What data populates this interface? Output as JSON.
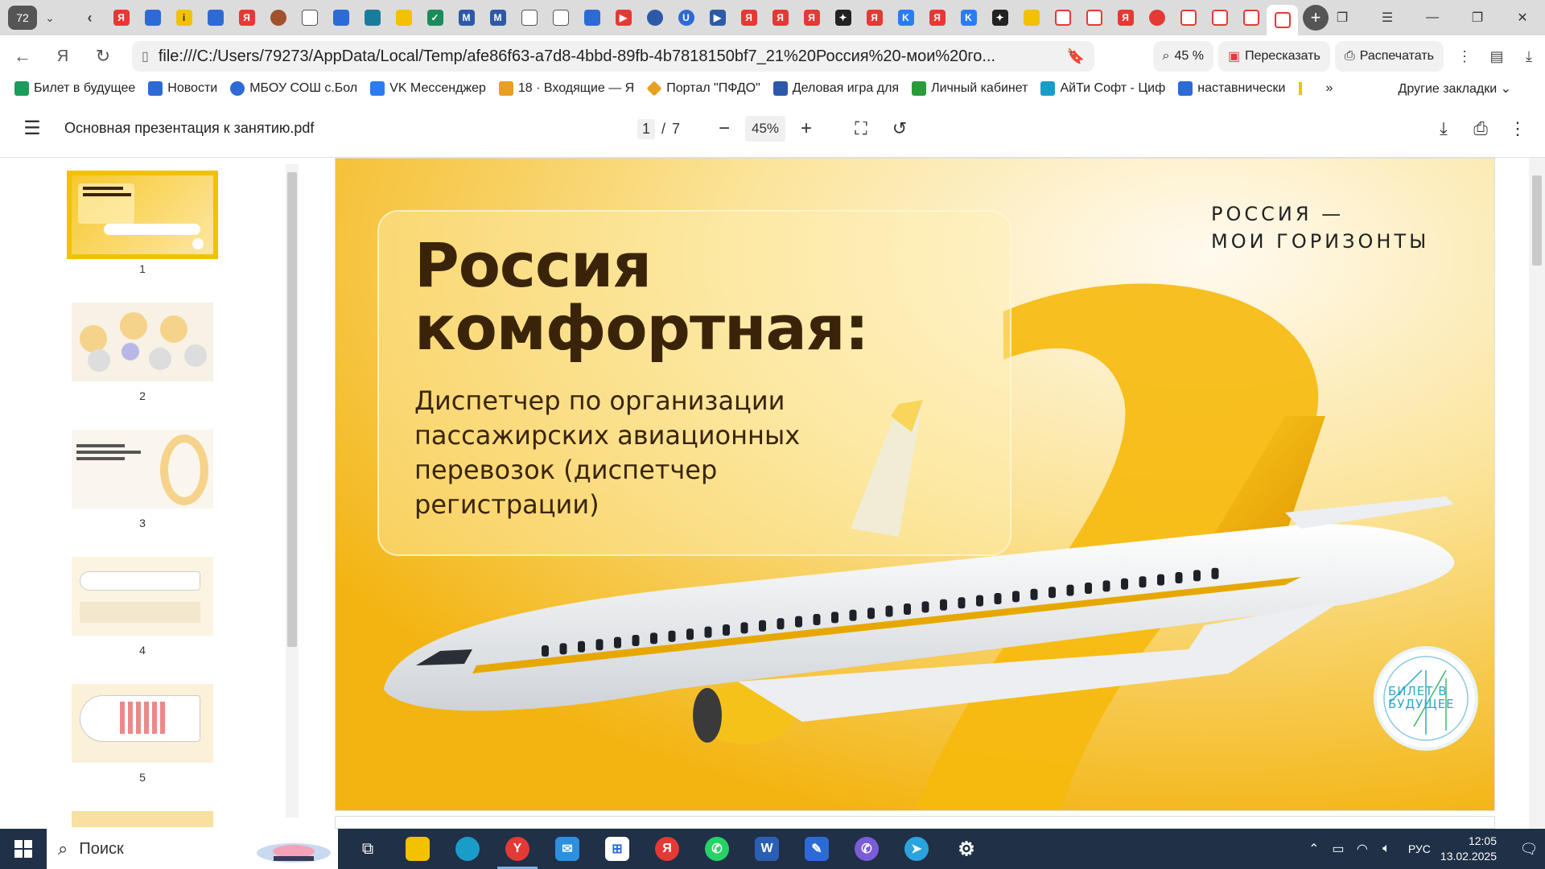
{
  "browser": {
    "tab_count": "72",
    "url": "file:///C:/Users/79273/AppData/Local/Temp/afe86f63-a7d8-4bbd-89fb-4b7818150bf7_21%20Россия%20-мои%20го...",
    "zoom_badge": "45 %",
    "retell_label": "Пересказать",
    "print_label": "Распечатать"
  },
  "bookmarks": {
    "items": [
      {
        "label": "Билет в будущее",
        "color": "#1a9c5b"
      },
      {
        "label": "Новости",
        "color": "#2d6ad6"
      },
      {
        "label": "МБОУ СОШ с.Бол",
        "color": "#2d6ad6"
      },
      {
        "label": "VK Мессенджер",
        "color": "#2b7cf2"
      },
      {
        "label": "18 · Входящие — Я",
        "color": "#e8a020"
      },
      {
        "label": "Портал \"ПФДО\"",
        "color": "#e8a020"
      },
      {
        "label": "Деловая игра для",
        "color": "#2d5aa8"
      },
      {
        "label": "Личный кабинет",
        "color": "#2b9b3a"
      },
      {
        "label": "АйТи Софт - Циф",
        "color": "#1a9cc8"
      },
      {
        "label": "наставнически",
        "color": "#2d6ad6"
      }
    ],
    "more": "»",
    "other": "Другие закладки"
  },
  "pdf": {
    "title": "Основная презентация к занятию.pdf",
    "page_current": "1",
    "page_sep": "/",
    "page_total": "7",
    "zoom": "45%"
  },
  "thumbnails": [
    {
      "num": "1"
    },
    {
      "num": "2"
    },
    {
      "num": "3"
    },
    {
      "num": "4"
    },
    {
      "num": "5"
    }
  ],
  "slide": {
    "title_line1": "Россия",
    "title_line2": "комфортная:",
    "subtitle": "Диспетчер по организации пассажирских авиационных перевозок (диспетчер регистрации)",
    "brand_line1": "РОССИЯ —",
    "brand_line2": "МОИ ГОРИЗОНТЫ",
    "badge_text": "БИЛЕТ В БУДУЩЕЕ"
  },
  "taskbar": {
    "search_placeholder": "Поиск",
    "lang": "РУС",
    "time": "12:05",
    "date": "13.02.2025"
  },
  "colors": {
    "accent_yellow": "#f5c21a",
    "title_brown": "#3a2409",
    "taskbar": "#1f3047"
  }
}
